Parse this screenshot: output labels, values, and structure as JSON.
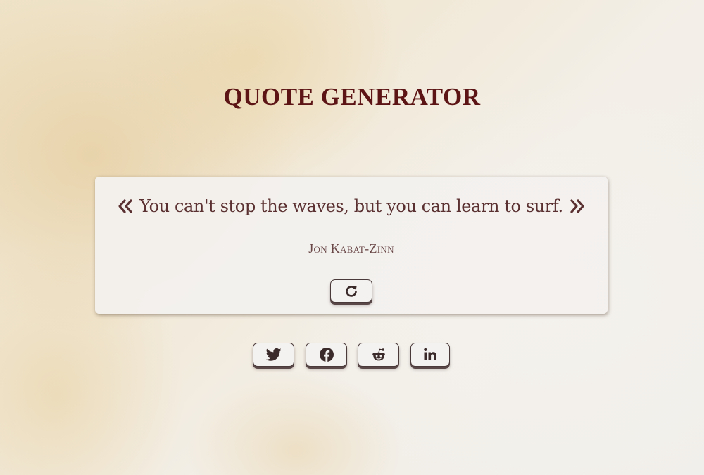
{
  "page": {
    "title": "QUOTE GENERATOR"
  },
  "quote": {
    "text": "You can't stop the waves, but you can learn to surf.",
    "author": "Jon Kabat-Zinn",
    "open_icon": "angle-double-left-icon",
    "close_icon": "angle-double-right-icon"
  },
  "actions": {
    "refresh_icon": "refresh-icon"
  },
  "share": [
    {
      "name": "twitter",
      "icon": "twitter-icon"
    },
    {
      "name": "facebook",
      "icon": "facebook-icon"
    },
    {
      "name": "reddit",
      "icon": "reddit-icon"
    },
    {
      "name": "linkedin",
      "icon": "linkedin-icon"
    }
  ],
  "colors": {
    "title": "#5c1414",
    "quote_text": "#5a3030",
    "author": "#6a4848",
    "icon": "#3a2a2a",
    "card_bg": "#f3f1ef"
  }
}
